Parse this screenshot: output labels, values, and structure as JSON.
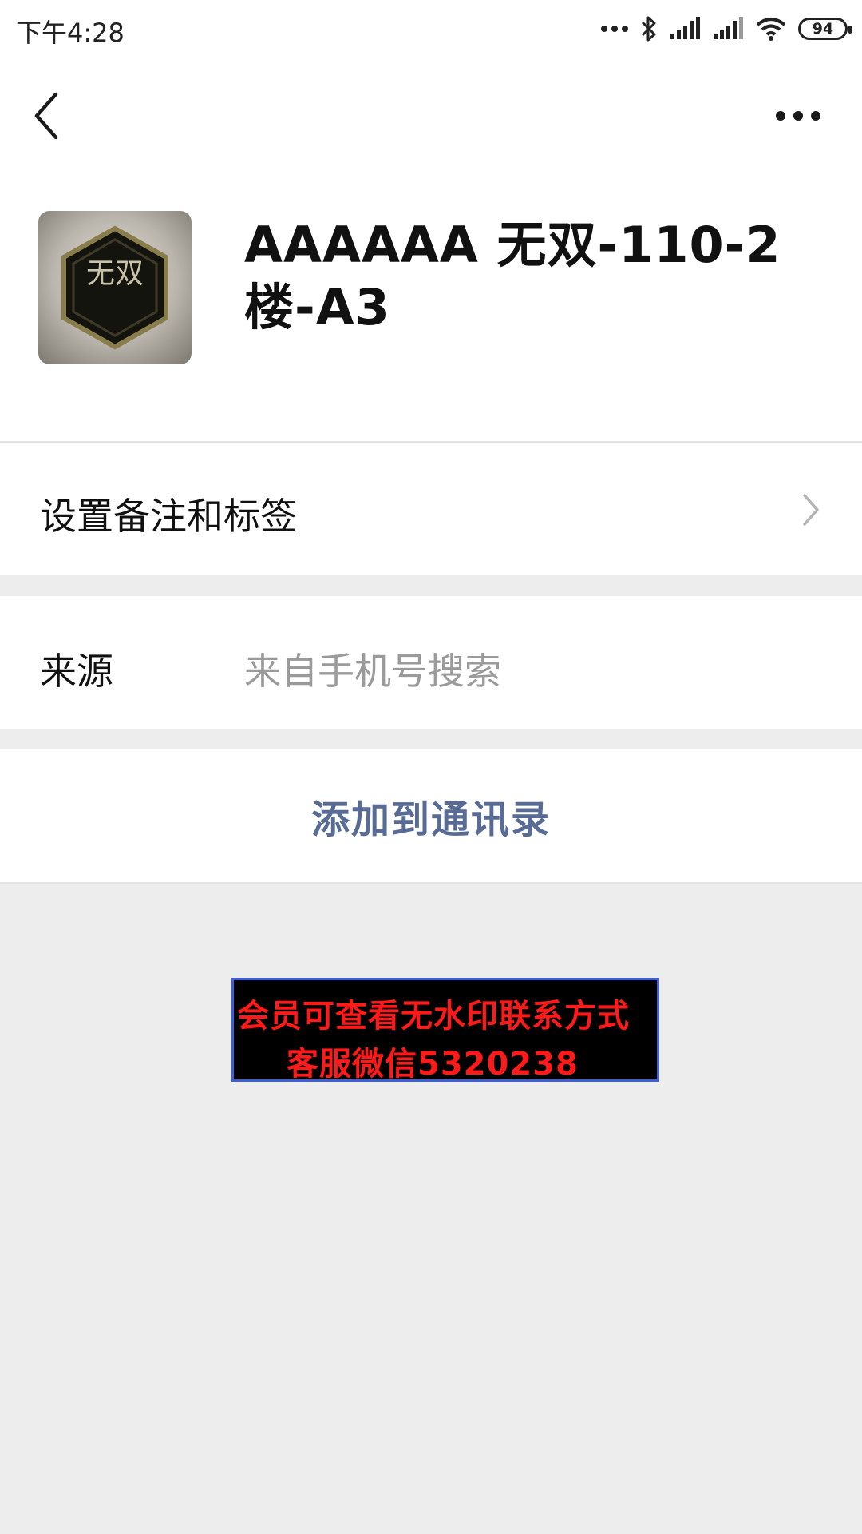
{
  "status_bar": {
    "time": "下午4:28",
    "battery": "94",
    "icons": [
      "more-dots-icon",
      "bluetooth-icon",
      "signal-icon",
      "signal-icon",
      "wifi-icon",
      "battery-icon"
    ]
  },
  "nav": {
    "back_icon": "chevron-left-icon",
    "more_icon": "more-horizontal-icon"
  },
  "profile": {
    "name": "AAAAAA 无双-110-2 楼-A3",
    "avatar_text": "无双"
  },
  "cells": {
    "remark_label": "设置备注和标签",
    "source_label": "来源",
    "source_value": "来自手机号搜索"
  },
  "actions": {
    "add_to_contacts": "添加到通讯录"
  },
  "watermark": {
    "line1": "会员可查看无水印联系方式",
    "line2": "客服微信5320238"
  },
  "colors": {
    "link": "#576b95",
    "page_bg": "#ededed",
    "watermark_text": "#ff1a1a"
  }
}
